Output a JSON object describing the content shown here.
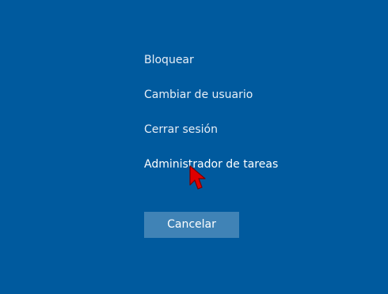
{
  "menu": {
    "items": [
      {
        "label": "Bloquear"
      },
      {
        "label": "Cambiar de usuario"
      },
      {
        "label": "Cerrar sesión"
      },
      {
        "label": "Administrador de tareas"
      }
    ]
  },
  "cancel_button": {
    "label": "Cancelar"
  },
  "pointer": {
    "icon": "arrow-cursor-icon",
    "color": "#e00000"
  },
  "colors": {
    "background": "#005a9e",
    "button": "#4083b6",
    "text": "#ffffff"
  }
}
